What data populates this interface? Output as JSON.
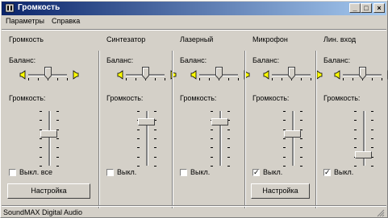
{
  "window": {
    "title": "Громкость"
  },
  "menu": [
    "Параметры",
    "Справка"
  ],
  "labels": {
    "balance": "Баланс:",
    "volume": "Громкость:"
  },
  "channels": [
    {
      "title": "Громкость",
      "mute_label": "Выкл. все",
      "muted": false,
      "button": "Настройка",
      "volume_level": 0.6,
      "balance": 0.5
    },
    {
      "title": "Синтезатор",
      "mute_label": "Выкл.",
      "muted": false,
      "button": "",
      "volume_level": 0.85,
      "balance": 0.5
    },
    {
      "title": "Лазерный",
      "mute_label": "Выкл.",
      "muted": false,
      "button": "",
      "volume_level": 0.85,
      "balance": 0.5
    },
    {
      "title": "Микрофон",
      "mute_label": "Выкл.",
      "muted": true,
      "button": "Настройка",
      "volume_level": 0.6,
      "balance": 0.5
    },
    {
      "title": "Лин. вход",
      "mute_label": "Выкл.",
      "muted": true,
      "button": "",
      "volume_level": 0.15,
      "balance": 0.5
    }
  ],
  "status": {
    "device": "SoundMAX Digital Audio"
  },
  "colors": {
    "titlebar_start": "#0a246a",
    "titlebar_end": "#a6caf0",
    "face": "#d4d0c8"
  },
  "icons": [
    "speaker-left-icon",
    "speaker-right-icon",
    "minimize-icon",
    "maximize-icon",
    "close-icon"
  ]
}
